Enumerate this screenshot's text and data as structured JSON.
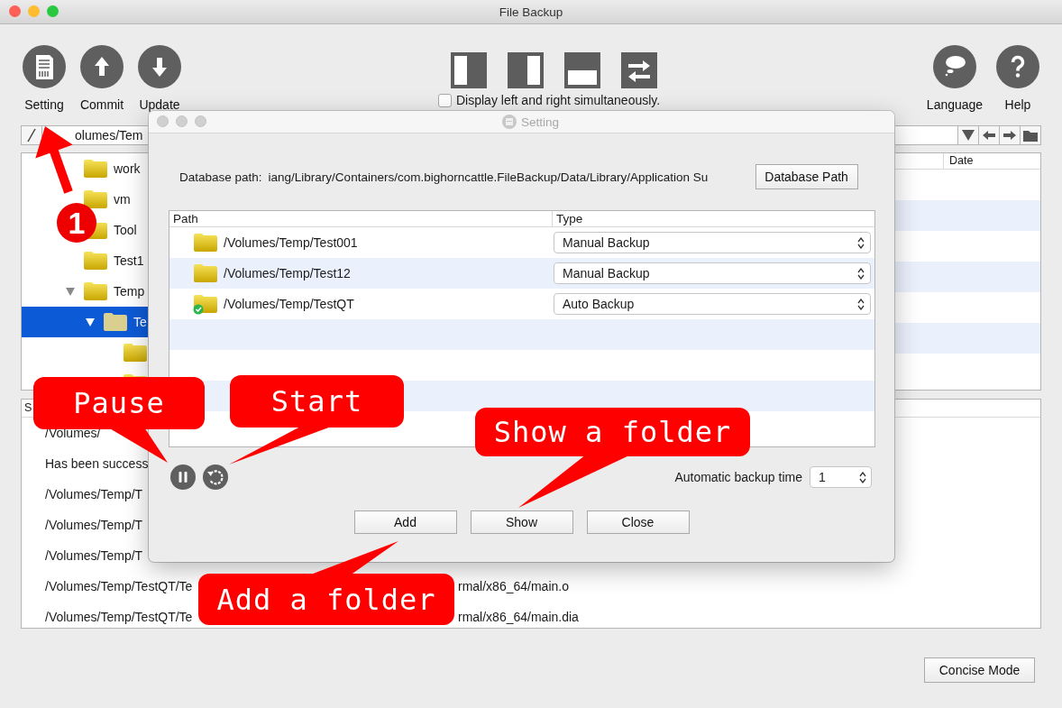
{
  "window": {
    "title": "File Backup"
  },
  "toolbar": {
    "left": [
      {
        "kind": "setting",
        "label": "Setting"
      },
      {
        "kind": "commit",
        "label": "Commit"
      },
      {
        "kind": "update",
        "label": "Update"
      }
    ],
    "display_both": {
      "label": "Display left and right simultaneously.",
      "checked": false
    },
    "right": [
      {
        "kind": "language",
        "label": "Language"
      },
      {
        "kind": "help",
        "label": "Help"
      }
    ]
  },
  "path_bar": {
    "value": "olumes/Tem"
  },
  "browser": {
    "date_column": "Date",
    "tree": [
      {
        "label": "work",
        "selected": false
      },
      {
        "label": "vm",
        "selected": false
      },
      {
        "label": "Tool",
        "selected": false
      },
      {
        "label": "Test1",
        "selected": false
      },
      {
        "label": "Temp",
        "selected": false,
        "expanded": true,
        "children": [
          {
            "label": "Te",
            "selected": true,
            "expanded": true,
            "children": [
              {
                "selected": false
              },
              {
                "selected": false
              }
            ]
          }
        ]
      }
    ]
  },
  "log": {
    "header": "S",
    "rows": [
      {
        "text": "/Volumes/"
      },
      {
        "text": "Has been success"
      },
      {
        "text": "/Volumes/Temp/T"
      },
      {
        "text": "/Volumes/Temp/T"
      },
      {
        "text": "/Volumes/Temp/T"
      },
      {
        "text": "/Volumes/Temp/TestQT/Te",
        "tail": "rmal/x86_64/main.o"
      },
      {
        "text": "/Volumes/Temp/TestQT/Te",
        "tail": "rmal/x86_64/main.dia"
      }
    ]
  },
  "concise_button": "Concise Mode",
  "dialog": {
    "title": "Setting",
    "db_label": "Database path:",
    "db_path": "iang/Library/Containers/com.bighorncattle.FileBackup/Data/Library/Application Su",
    "db_button": "Database Path",
    "columns": [
      "Path",
      "Type"
    ],
    "rows": [
      {
        "path": "/Volumes/Temp/Test001",
        "type": "Manual Backup",
        "synced": false
      },
      {
        "path": "/Volumes/Temp/Test12",
        "type": "Manual Backup",
        "synced": false
      },
      {
        "path": "/Volumes/Temp/TestQT",
        "type": "Auto Backup",
        "synced": true
      }
    ],
    "auto_time": {
      "label": "Automatic backup time",
      "value": "1"
    },
    "buttons": [
      "Add",
      "Show",
      "Close"
    ]
  },
  "annotations": [
    {
      "kind": "callout",
      "text": "Pause"
    },
    {
      "kind": "callout",
      "text": "Start"
    },
    {
      "kind": "callout",
      "text": "Show a folder"
    },
    {
      "kind": "callout",
      "text": "Add a folder"
    },
    {
      "kind": "arrow"
    },
    {
      "kind": "badge",
      "text": "1"
    }
  ]
}
